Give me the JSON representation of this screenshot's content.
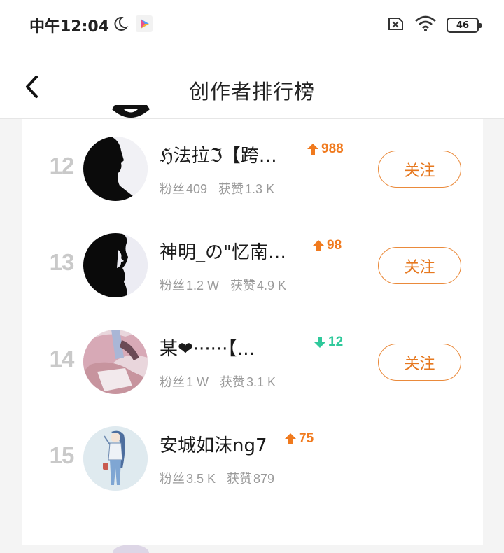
{
  "status_bar": {
    "time": "中午12:04",
    "battery": "46"
  },
  "nav": {
    "title": "创作者排行榜"
  },
  "labels": {
    "fans": "粉丝",
    "likes": "获赞"
  },
  "colors": {
    "accent": "#f07a1e",
    "down": "#2fc99b"
  },
  "creators": [
    {
      "rank": "12",
      "name": "ℌ法拉ℑ【跨…",
      "trend_dir": "up",
      "trend": "988",
      "fans": "409",
      "likes": "1.3 K",
      "follow": "关注",
      "avatar": "silhouette-profile"
    },
    {
      "rank": "13",
      "name": "神明_の\"忆南…",
      "trend_dir": "up",
      "trend": "98",
      "fans": "1.2 W",
      "likes": "4.9 K",
      "follow": "关注",
      "avatar": "silhouette-long-hair"
    },
    {
      "rank": "14",
      "name": "某❤······【…",
      "trend_dir": "down",
      "trend": "12",
      "fans": "1 W",
      "likes": "3.1 K",
      "follow": "关注",
      "avatar": "anime-pink"
    },
    {
      "rank": "15",
      "name": "安城如沫ng7",
      "trend_dir": "up",
      "trend": "75",
      "fans": "3.5 K",
      "likes": "879",
      "avatar": "anime-girl-blue"
    }
  ]
}
